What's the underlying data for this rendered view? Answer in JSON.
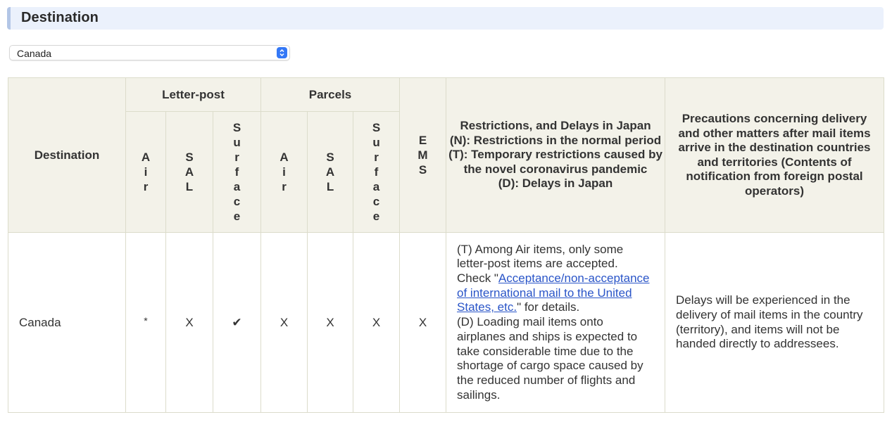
{
  "section": {
    "title": "Destination"
  },
  "destination_select": {
    "selected": "Canada",
    "icon": "up-down-chevron-icon"
  },
  "table": {
    "headers": {
      "destination": "Destination",
      "letter_post": "Letter-post",
      "parcels": "Parcels",
      "ems": "EMS",
      "sub": {
        "air": "Air",
        "sal": "SAL",
        "surface": "Surface"
      },
      "restrictions": [
        "Restrictions, and Delays in Japan",
        "(N): Restrictions in the normal period",
        "(T): Temporary restrictions caused by the novel coronavirus pandemic",
        "(D): Delays in Japan"
      ],
      "precautions": "Precautions concerning delivery and other matters after mail items arrive in the destination countries and territories (Contents of notification from foreign postal operators)"
    },
    "rows": [
      {
        "destination": "Canada",
        "letter_post": {
          "air": "*",
          "sal": "X",
          "surface": "✔"
        },
        "parcels": {
          "air": "X",
          "sal": "X",
          "surface": "X"
        },
        "ems": "X",
        "restrictions": {
          "t_text": "(T) Among Air items, only some letter-post items are accepted. Check \"",
          "link_text": "Acceptance/non-acceptance of international mail to the United States, etc.",
          "t_after": "\" for details.",
          "d_text": "(D) Loading mail items onto airplanes and ships is expected to take considerable time due to the shortage of cargo space caused by the reduced number of flights and sailings."
        },
        "precautions": "Delays will be experienced in the delivery of mail items in the country (territory), and items will not be handed directly to addressees."
      }
    ]
  },
  "colors": {
    "header_bg": "#f3f2e9",
    "border": "#dcdccb",
    "link": "#2a55c8",
    "title_bg": "#ebf1fc",
    "select_accent": "#3478f6"
  }
}
